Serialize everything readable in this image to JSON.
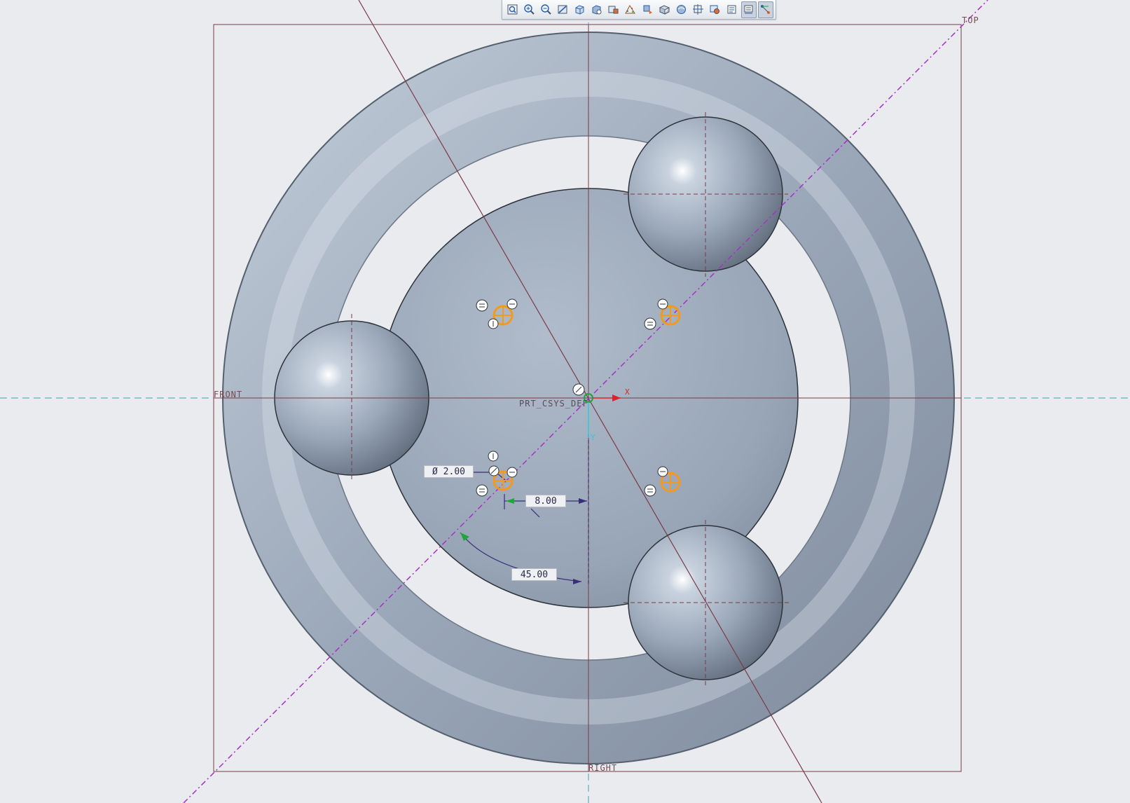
{
  "toolbar": {
    "buttons": [
      {
        "icon": "refit-icon"
      },
      {
        "icon": "zoom-in-icon"
      },
      {
        "icon": "zoom-out-icon"
      },
      {
        "icon": "repaint-icon"
      },
      {
        "icon": "display-style-icon"
      },
      {
        "icon": "saved-orientations-icon"
      },
      {
        "icon": "view-manager-icon"
      },
      {
        "icon": "perspective-icon"
      },
      {
        "icon": "datum-display-icon"
      },
      {
        "icon": "annotation-display-icon"
      },
      {
        "icon": "spin-center-icon"
      },
      {
        "icon": "sketch-view-icon"
      },
      {
        "icon": "sketcher-display-icon"
      },
      {
        "icon": "sketcher-filter-icon"
      },
      {
        "icon": "dimension-display-icon"
      },
      {
        "icon": "constraint-display-icon"
      }
    ],
    "active_icons": [
      "dimension-display-icon",
      "constraint-display-icon"
    ]
  },
  "datum_planes": {
    "top": "TOP",
    "front": "FRONT",
    "right": "RIGHT"
  },
  "csys": {
    "name": "PRT_CSYS_DEF",
    "x_axis": "X",
    "y_axis": "Y"
  },
  "dimensions": {
    "diameter": "Ø 2.00",
    "radius": "8.00",
    "angle": "45.00"
  },
  "colors": {
    "background": "#e9ebef",
    "model": "#9aa7b8",
    "centerline": "#a830c8",
    "datum_axis": "#3aa7b0",
    "datum_plane": "#7a3b48",
    "sketch_point": "#f39a1e"
  }
}
